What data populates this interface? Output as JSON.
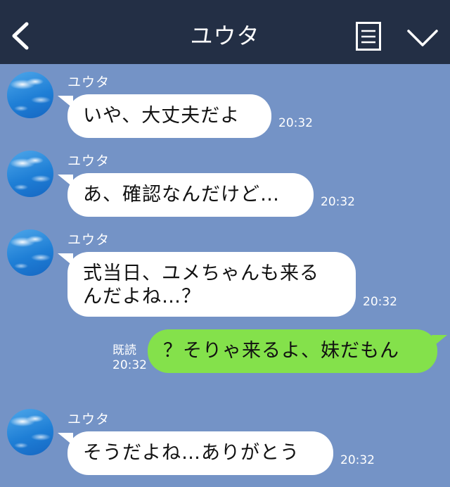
{
  "header": {
    "title": "ユウタ"
  },
  "messages": [
    {
      "sender": "ユウタ",
      "text": "いや、大丈夫だよ",
      "time": "20:32"
    },
    {
      "sender": "ユウタ",
      "text": "あ、確認なんだけど…",
      "time": "20:32"
    },
    {
      "sender": "ユウタ",
      "line1": "式当日、ユメちゃんも来る",
      "line2": "んだよね…？",
      "time": "20:32"
    },
    {
      "read": "既読",
      "text": "？そりゃ来るよ、妹だもん",
      "time": "20:32"
    },
    {
      "sender": "ユウタ",
      "text": "そうだよね…ありがとう",
      "time": "20:32"
    }
  ],
  "colors": {
    "header_bg": "#232f45",
    "chat_bg": "#7493c6",
    "outgoing_bubble": "#84e14b",
    "incoming_bubble": "#ffffff"
  },
  "icons": [
    "back-icon",
    "menu-icon",
    "chevron-down-icon",
    "avatar"
  ]
}
